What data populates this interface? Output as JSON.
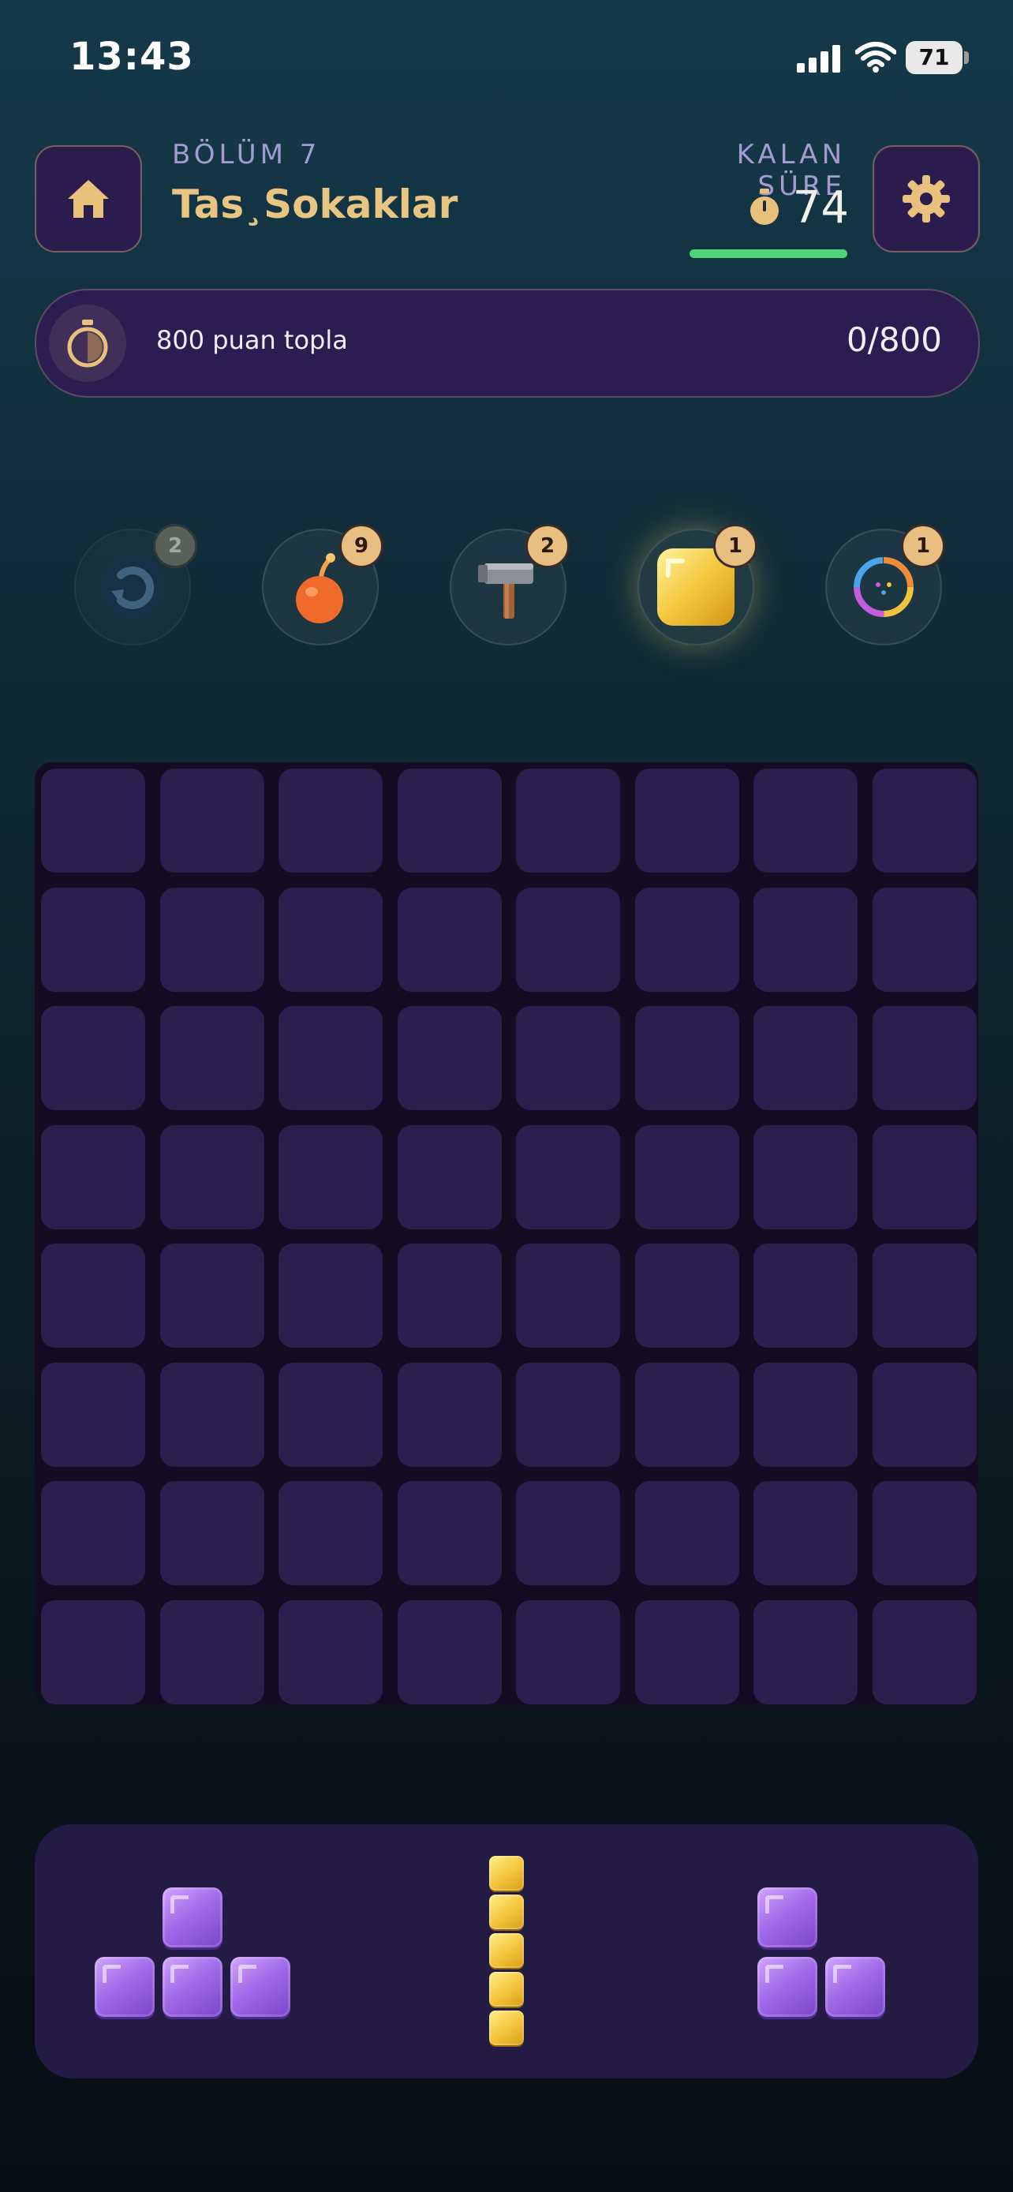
{
  "status_bar": {
    "time": "13:43",
    "battery": "71"
  },
  "header": {
    "level_label": "BÖLÜM 7",
    "level_title": "Tas¸Sokaklar",
    "time_label": "KALAN SÜRE",
    "time_remaining": "74",
    "timer_bar_color": "#4fd27a"
  },
  "goal": {
    "text": "800 puan topla",
    "progress": "0/800"
  },
  "boosters": [
    {
      "name": "undo-icon",
      "count": "2",
      "state": "disabled"
    },
    {
      "name": "bomb-icon",
      "count": "9",
      "state": "normal"
    },
    {
      "name": "hammer-icon",
      "count": "2",
      "state": "normal"
    },
    {
      "name": "gold-block-icon",
      "count": "1",
      "state": "active"
    },
    {
      "name": "rainbow-ring-icon",
      "count": "1",
      "state": "normal"
    }
  ],
  "board": {
    "rows": 8,
    "cols": 8,
    "cell_color": "#2a1f4d"
  },
  "tray": {
    "pieces": [
      {
        "name": "t-piece",
        "color": "#a36be8"
      },
      {
        "name": "i-piece-vertical",
        "color": "#f3c43b"
      },
      {
        "name": "l-piece-small",
        "color": "#a36be8"
      }
    ]
  }
}
